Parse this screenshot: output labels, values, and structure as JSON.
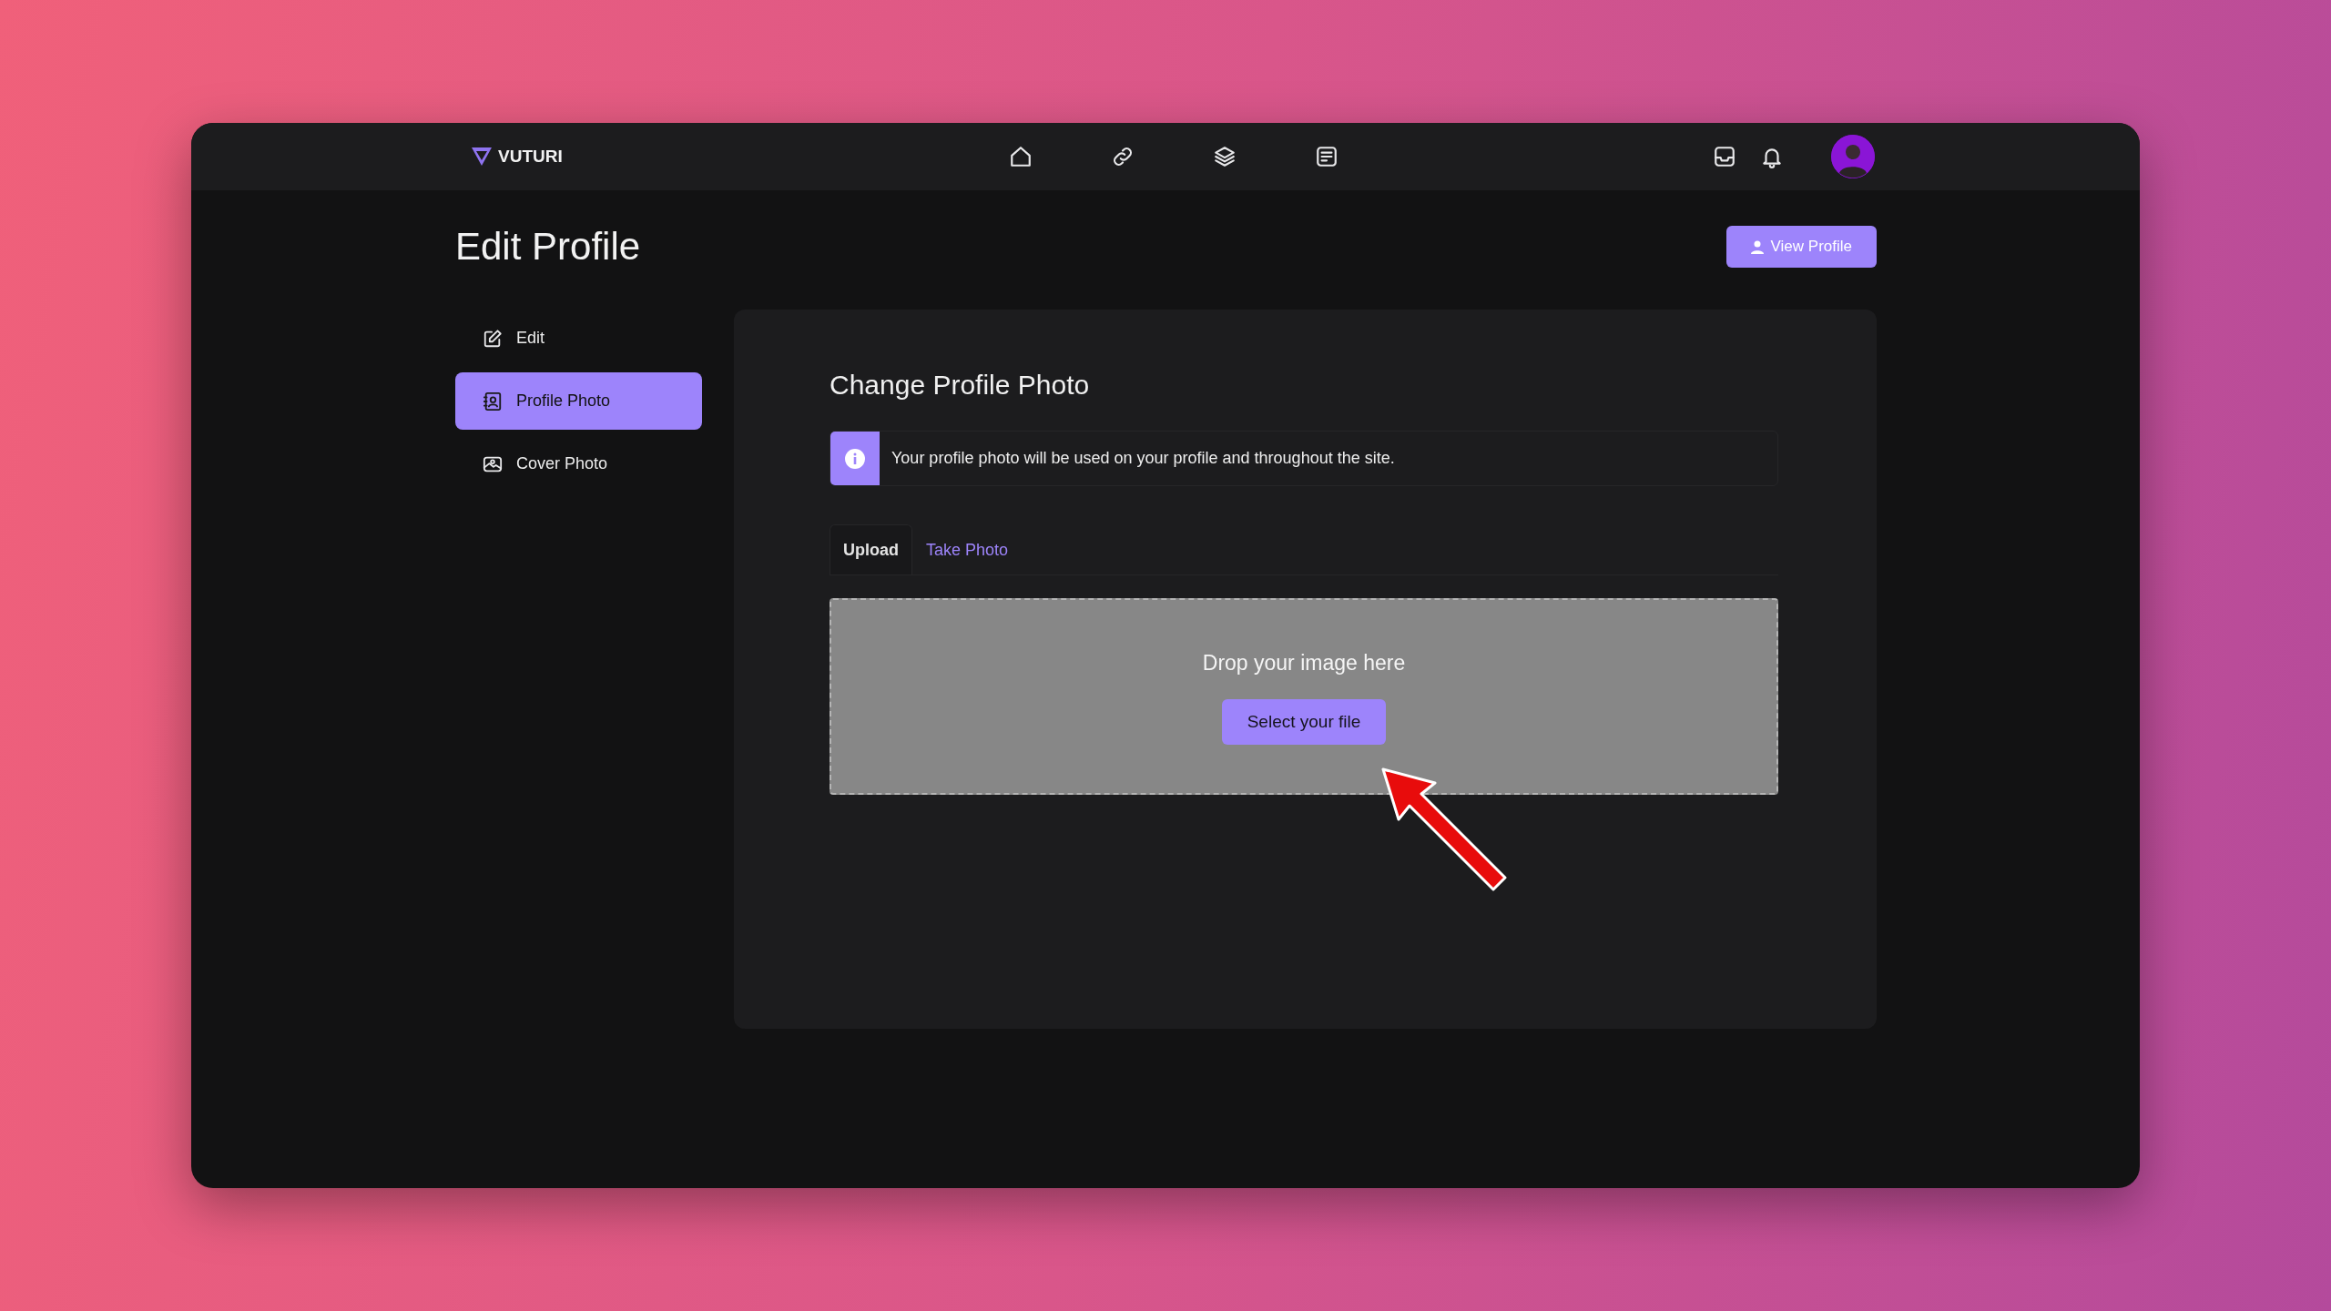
{
  "brand": {
    "name": "VUTURI"
  },
  "page": {
    "title": "Edit Profile",
    "view_button": "View Profile"
  },
  "sidebar": {
    "items": [
      {
        "label": "Edit",
        "kind": "edit",
        "selected": false
      },
      {
        "label": "Profile Photo",
        "kind": "profile",
        "selected": true
      },
      {
        "label": "Cover Photo",
        "kind": "cover",
        "selected": false
      }
    ]
  },
  "panel": {
    "title": "Change Profile Photo",
    "notice": "Your profile photo will be used on your profile and throughout the site.",
    "tabs": [
      {
        "label": "Upload",
        "selected": true
      },
      {
        "label": "Take Photo",
        "selected": false
      }
    ],
    "dropzone": {
      "prompt": "Drop your image here",
      "button": "Select your file"
    }
  }
}
